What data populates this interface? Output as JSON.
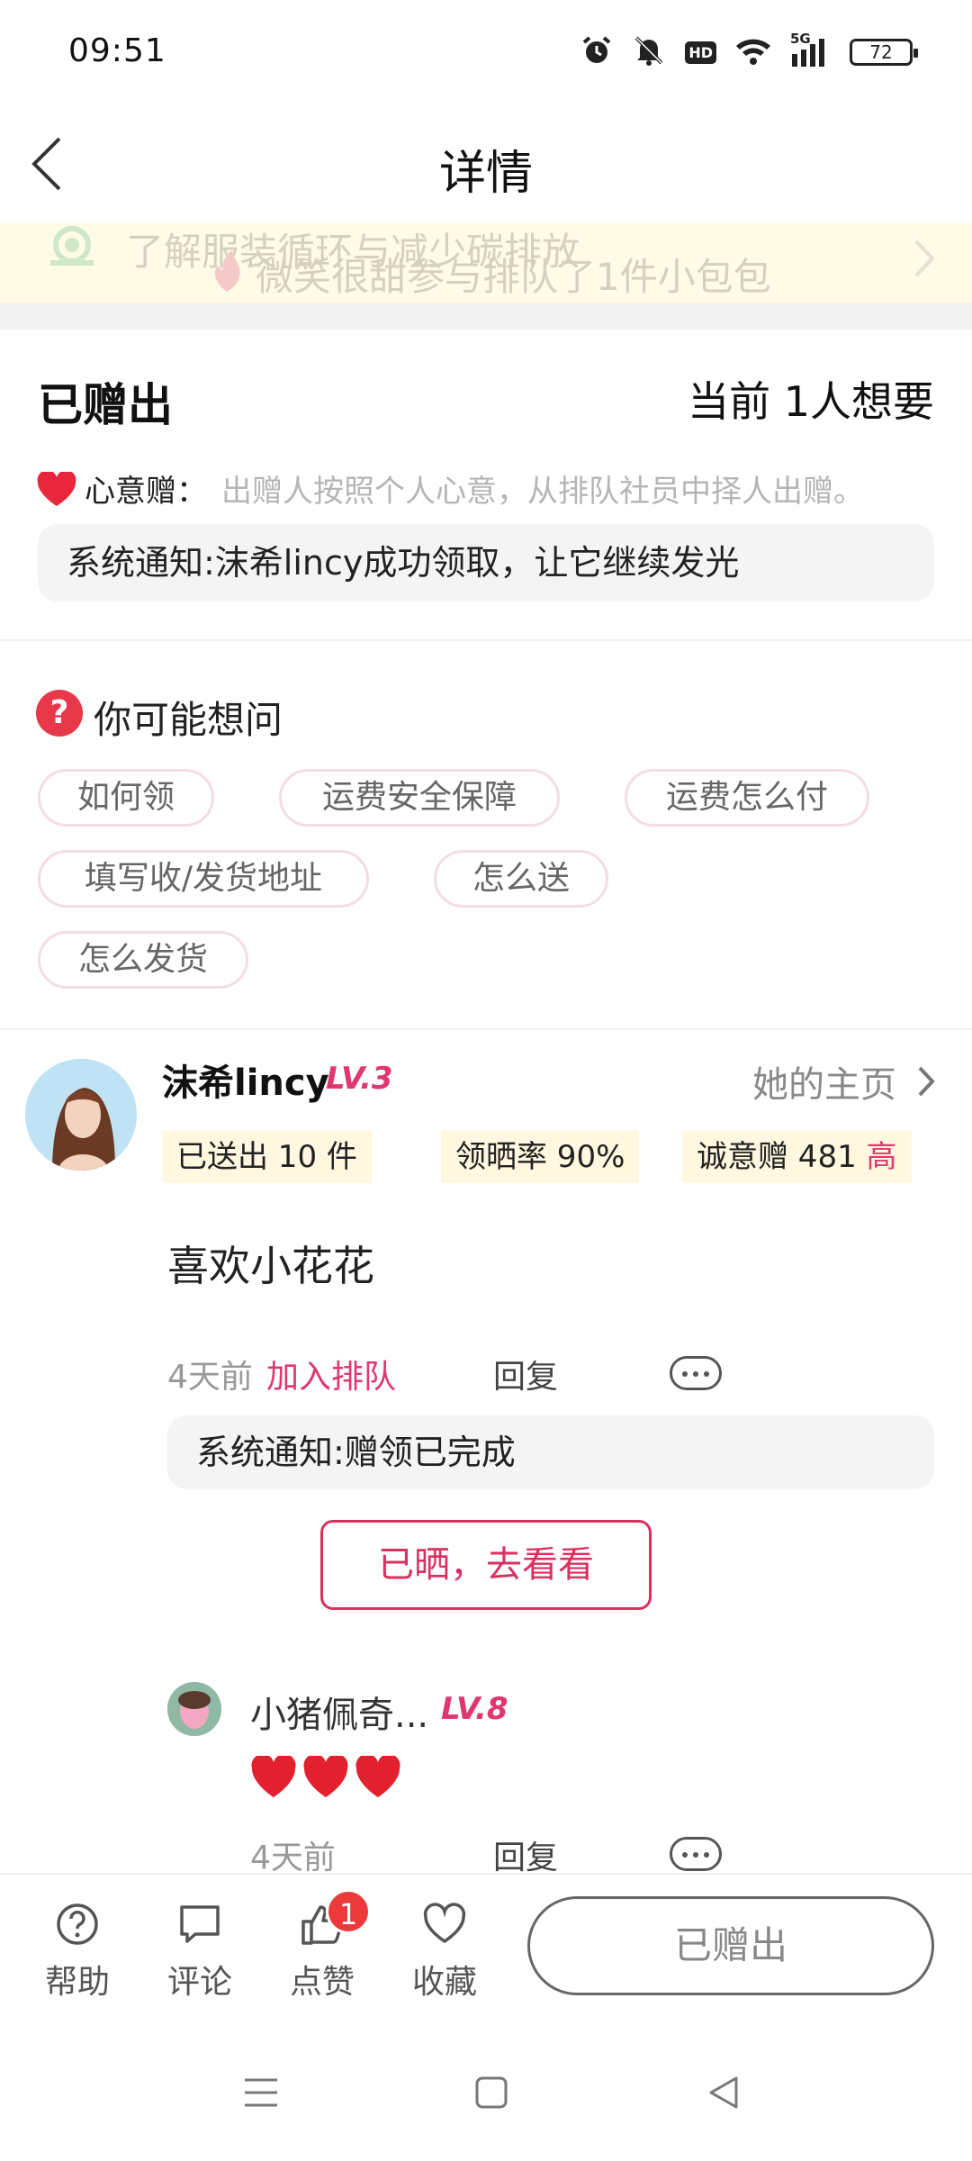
{
  "status_bar": {
    "time": "09:51",
    "hd_label": "HD",
    "network_label": "5G",
    "battery": "72"
  },
  "header": {
    "title": "详情"
  },
  "notice": {
    "line1": "了解服装循环与减少碳排放",
    "line2": "微笑很甜参与排队了1件小包包"
  },
  "gift": {
    "status": "已赠出",
    "want_count": "当前 1人想要",
    "giving_type": "心意赠：",
    "giving_desc": "出赠人按照个人心意，从排队社员中择人出赠。",
    "system_notice": "系统通知:沫希lincy成功领取，让它继续发光"
  },
  "faq": {
    "title": "你可能想问",
    "icon_text": "?",
    "chips": [
      "如何领",
      "运费安全保障",
      "运费怎么付",
      "填写收/发货地址",
      "怎么送",
      "怎么发货"
    ]
  },
  "comment": {
    "user_name": "沫希lincy",
    "user_level": "LV.3",
    "homepage_link": "她的主页",
    "stats": {
      "sent": "已送出 10 件",
      "rate": "领晒率 90%",
      "sincerity": "诚意赠 481",
      "sincerity_level": "高"
    },
    "text": "喜欢小花花",
    "time": "4天前",
    "action": "加入排队",
    "reply_label": "回复",
    "system_notice": "系统通知:赠领已完成",
    "shared_button": "已晒，去看看"
  },
  "reply": {
    "user_name": "小猪佩奇...",
    "user_level": "LV.8",
    "content_hearts": 3,
    "time": "4天前",
    "reply_label": "回复"
  },
  "bottom_bar": {
    "help": "帮助",
    "comment": "评论",
    "like": "点赞",
    "like_badge": "1",
    "favorite": "收藏",
    "main_button": "已赠出"
  },
  "colors": {
    "accent": "#e0386e",
    "notice_bg": "#fffbe7",
    "stat_bg": "#fff7e0",
    "badge_red": "#ec3a3a"
  }
}
